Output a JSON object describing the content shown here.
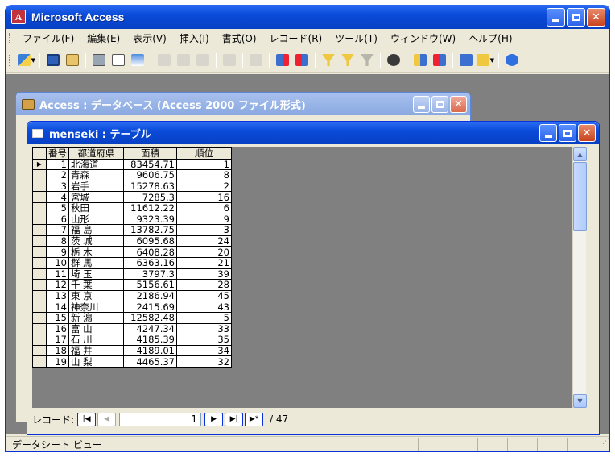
{
  "app": {
    "title": "Microsoft Access",
    "icon_letter": "A"
  },
  "menu": [
    "ファイル(F)",
    "編集(E)",
    "表示(V)",
    "挿入(I)",
    "書式(O)",
    "レコード(R)",
    "ツール(T)",
    "ウィンドウ(W)",
    "ヘルプ(H)"
  ],
  "toolbar_icons": [
    "view-icon",
    "save-icon",
    "search-db-icon",
    "print-icon",
    "print-preview-icon",
    "spelling-icon",
    "cut-icon",
    "copy-icon",
    "paste-icon",
    "undo-icon",
    "hyperlink-icon",
    "sort-ascending-icon",
    "sort-descending-icon",
    "filter-by-selection-icon",
    "filter-by-form-icon",
    "apply-filter-icon",
    "find-icon",
    "new-record-icon",
    "delete-record-icon",
    "database-window-icon",
    "new-object-icon",
    "help-icon"
  ],
  "db_window": {
    "title": "Access : データベース (Access 2000 ファイル形式)"
  },
  "table_window": {
    "title": "menseki : テーブル",
    "columns": [
      "番号",
      "都道府県",
      "面積",
      "順位"
    ],
    "rows": [
      [
        "1",
        "北海道",
        "83454.71",
        "1"
      ],
      [
        "2",
        "青森",
        "9606.75",
        "8"
      ],
      [
        "3",
        "岩手",
        "15278.63",
        "2"
      ],
      [
        "4",
        "宮城",
        "7285.3",
        "16"
      ],
      [
        "5",
        "秋田",
        "11612.22",
        "6"
      ],
      [
        "6",
        "山形",
        "9323.39",
        "9"
      ],
      [
        "7",
        "福 島",
        "13782.75",
        "3"
      ],
      [
        "8",
        "茨 城",
        "6095.68",
        "24"
      ],
      [
        "9",
        "栃 木",
        "6408.28",
        "20"
      ],
      [
        "10",
        "群 馬",
        "6363.16",
        "21"
      ],
      [
        "11",
        "埼 玉",
        "3797.3",
        "39"
      ],
      [
        "12",
        "千 葉",
        "5156.61",
        "28"
      ],
      [
        "13",
        "東 京",
        "2186.94",
        "45"
      ],
      [
        "14",
        "神奈川",
        "2415.69",
        "43"
      ],
      [
        "15",
        "新 潟",
        "12582.48",
        "5"
      ],
      [
        "16",
        "富 山",
        "4247.34",
        "33"
      ],
      [
        "17",
        "石 川",
        "4185.39",
        "35"
      ],
      [
        "18",
        "福 井",
        "4189.01",
        "34"
      ],
      [
        "19",
        "山 梨",
        "4465.37",
        "32"
      ]
    ],
    "current_record_marker": "▶"
  },
  "navigation": {
    "label": "レコード:",
    "current": "1",
    "total": "/ 47"
  },
  "status": {
    "text": "データシート ビュー"
  }
}
